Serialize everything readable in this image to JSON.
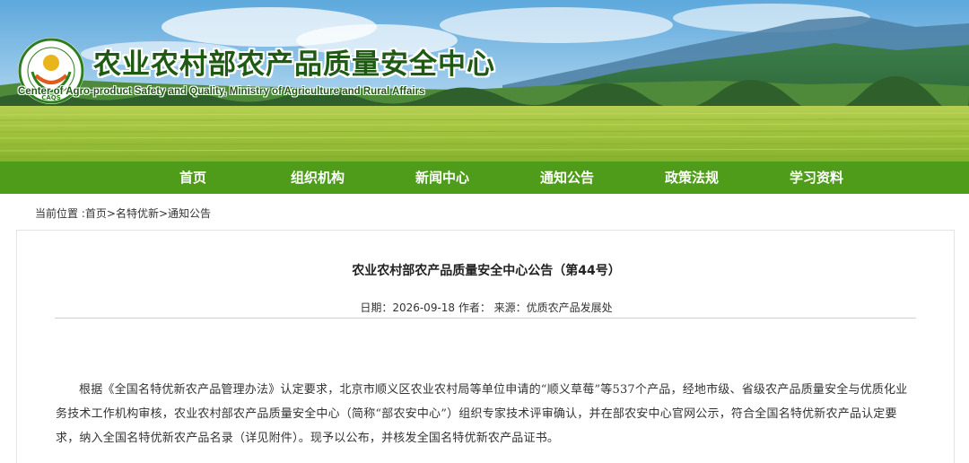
{
  "header": {
    "title": "农业农村部农产品质量安全中心",
    "subtitle": "Center of Agro-product Safety and Quality, Ministry of Agriculture and Rural Affairs",
    "logo_text": "CAQS",
    "logo_ring_text": "安全 优质 营养 健康"
  },
  "nav": {
    "items": [
      "首页",
      "组织机构",
      "新闻中心",
      "通知公告",
      "政策法规",
      "学习资料"
    ]
  },
  "breadcrumb": {
    "prefix": "当前位置 :",
    "home": "首页",
    "sep1": ">",
    "section": "名特优新",
    "sep2": ">",
    "current": "通知公告"
  },
  "article": {
    "title": "农业农村部农产品质量安全中心公告（第44号）",
    "meta": "日期：2026-09-18 作者：  来源：优质农产品发展处",
    "body": "根据《全国名特优新农产品管理办法》认定要求，北京市顺义区农业农村局等单位申请的“顺义草莓”等537个产品，经地市级、省级农产品质量安全与优质化业务技术工作机构审核，农业农村部农产品质量安全中心（简称“部农安中心”）组织专家技术评审确认，并在部农安中心官网公示，符合全国名特优新农产品认定要求，纳入全国名特优新农产品名录（详见附件）。现予以公布，并核发全国名特优新农产品证书。"
  },
  "colors": {
    "nav_green": "#4f9c1a",
    "title_green": "#1e5a12"
  }
}
